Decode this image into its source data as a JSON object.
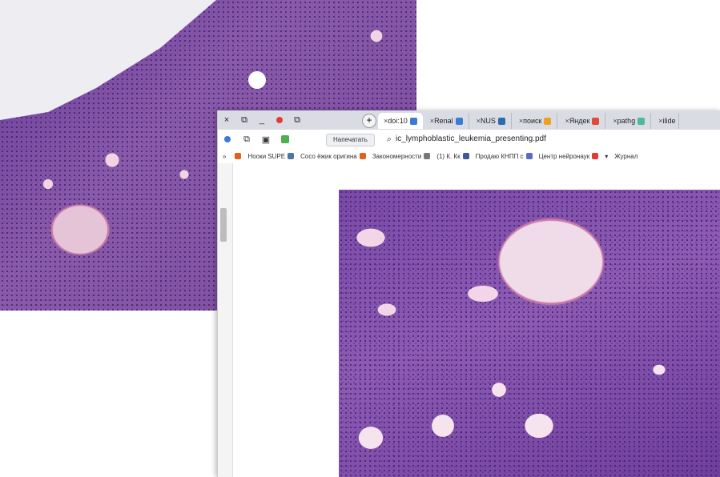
{
  "tabs": [
    {
      "label": "ilide",
      "color": "#6ab0e6"
    },
    {
      "label": "pathg",
      "color": "#4bb9a0"
    },
    {
      "label": "Яндек",
      "color": "#e04a3a"
    },
    {
      "label": "поиск",
      "color": "#f0a020"
    },
    {
      "label": "NUS",
      "color": "#2b6cb0"
    },
    {
      "label": "Renal",
      "color": "#3a7bd5"
    },
    {
      "label": "doi:10",
      "color": "#3a7bd5",
      "active": true
    }
  ],
  "toolbar": {
    "print_label": "Напечатать",
    "url": "ic_lymphoblastic_leukemia_presenting.pdf"
  },
  "bookmarks": [
    {
      "label": "Журнал",
      "color": "#999999"
    },
    {
      "label": "Центр нейронаук",
      "color": "#e53935"
    },
    {
      "label": "Продаю КНПП с",
      "color": "#5c6bc0"
    },
    {
      "label": "(1) К. Кк",
      "color": "#3b5998"
    },
    {
      "label": "Закономерности",
      "color": "#777777"
    },
    {
      "label": "Сосо ёжик оригина",
      "color": "#e06020"
    },
    {
      "label": "Нооки SUPE",
      "color": "#4a76a8"
    }
  ],
  "icons": {
    "close": "×",
    "restore": "⧉",
    "minimize": "_",
    "new_tab": "+",
    "more": "»"
  }
}
